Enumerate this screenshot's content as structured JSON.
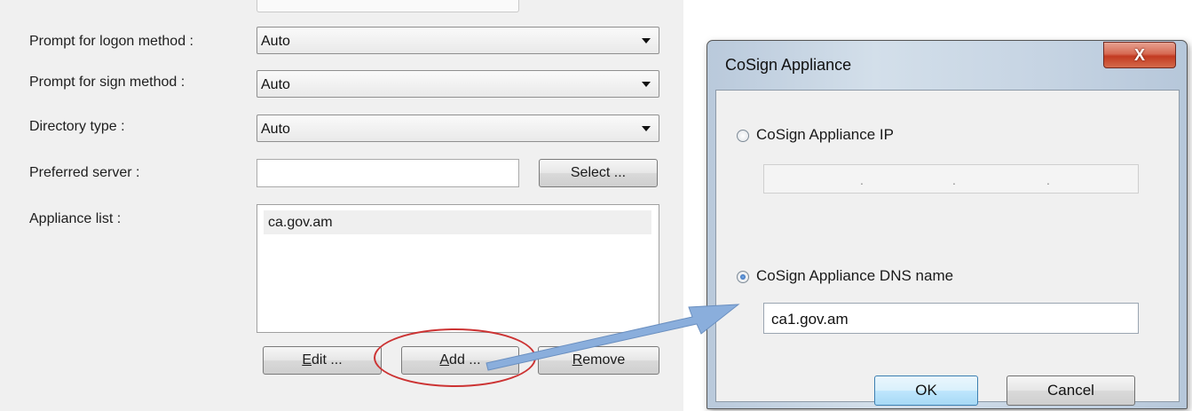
{
  "panel": {
    "logon_method_label": "Prompt for logon method :",
    "logon_method_value": "Auto",
    "sign_method_label": "Prompt for sign method :",
    "sign_method_value": "Auto",
    "directory_type_label": "Directory type :",
    "directory_type_value": "Auto",
    "preferred_server_label": "Preferred server :",
    "preferred_server_value": "",
    "select_button": "Select ...",
    "appliance_list_label": "Appliance list :",
    "appliance_list_items": [
      "ca.gov.am"
    ],
    "edit_button": {
      "key": "E",
      "rest": "dit ..."
    },
    "add_button": {
      "key": "A",
      "rest": "dd ..."
    },
    "remove_button": {
      "key": "R",
      "rest": "emove"
    }
  },
  "dialog": {
    "title": "CoSign Appliance",
    "close_glyph": "X",
    "ip_option_label": "CoSign Appliance IP",
    "ip_option_selected": false,
    "ip_dots": [
      ".",
      ".",
      "."
    ],
    "dns_option_label": "CoSign Appliance DNS name",
    "dns_option_selected": true,
    "dns_value": "ca1.gov.am",
    "ok_button": "OK",
    "cancel_button": "Cancel"
  },
  "colors": {
    "callout_ellipse": "#cc3333",
    "callout_arrow": "#8aaedc"
  }
}
